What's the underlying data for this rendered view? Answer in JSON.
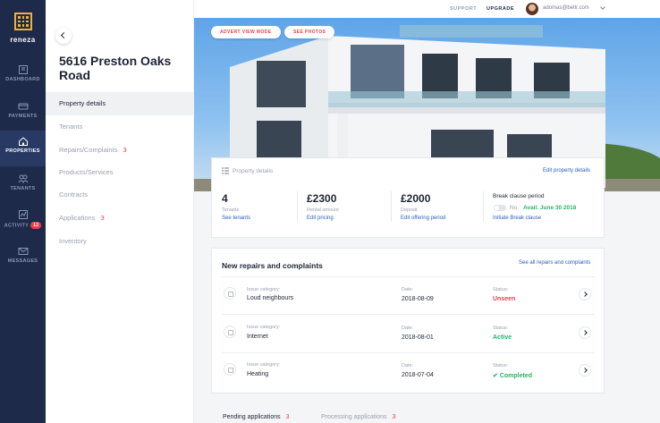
{
  "app": {
    "logo_text": "reneza"
  },
  "nav": {
    "items": [
      {
        "label": "DASHBOARD",
        "icon": "dashboard-icon"
      },
      {
        "label": "PAYMENTS",
        "icon": "payments-icon"
      },
      {
        "label": "PROPERTIES",
        "icon": "house-icon",
        "active": true
      },
      {
        "label": "TENANTS",
        "icon": "tenants-icon"
      },
      {
        "label": "ACTIVITY",
        "icon": "activity-icon",
        "badge": "12"
      },
      {
        "label": "MESSAGES",
        "icon": "mail-icon"
      }
    ]
  },
  "sidebar": {
    "title": "5616 Preston Oaks Road",
    "items": [
      {
        "label": "Property details",
        "active": true
      },
      {
        "label": "Tenants"
      },
      {
        "label": "Repairs/Complaints",
        "count": "3"
      },
      {
        "label": "Products/Services"
      },
      {
        "label": "Contracts"
      },
      {
        "label": "Applications",
        "count": "3"
      },
      {
        "label": "Inventory"
      }
    ]
  },
  "topbar": {
    "support": "SUPPORT",
    "upgrade": "UPGRADE",
    "email": "adomas@beltr.com"
  },
  "hero": {
    "advert_button": "ADVERT VIEW MODE",
    "photos_button": "SEE PHOTOS"
  },
  "details": {
    "heading": "Property details",
    "edit_link": "Edit property details",
    "tenants": {
      "value": "4",
      "label": "Tenants",
      "link": "See tenants"
    },
    "rental": {
      "value": "£2300",
      "label": "Rental amount",
      "link": "Edit pricing"
    },
    "deposit": {
      "value": "£2000",
      "label": "Deposit",
      "link": "Edit offering period"
    },
    "break": {
      "label": "Break clause period",
      "toggle": "No",
      "avail": "Avail. June 30 2018",
      "link": "Initiate Break clause"
    }
  },
  "repairs": {
    "title": "New repairs and complaints",
    "see_all": "See all repairs and complaints",
    "issue_label": "Issue category:",
    "date_label": "Date:",
    "status_label": "Status:",
    "rows": [
      {
        "category": "Loud neighbours",
        "date": "2018-08-09",
        "status": "Unseen",
        "status_color": "#e0454e"
      },
      {
        "category": "Internet",
        "date": "2018-08-01",
        "status": "Active",
        "status_color": "#2eb06a"
      },
      {
        "category": "Heating",
        "date": "2018-07-04",
        "status": "✔ Completed",
        "status_color": "#2eb06a"
      }
    ]
  },
  "tabs": [
    {
      "label": "Pending applications",
      "count": "3"
    },
    {
      "label": "Processing applications",
      "count": "3"
    }
  ]
}
